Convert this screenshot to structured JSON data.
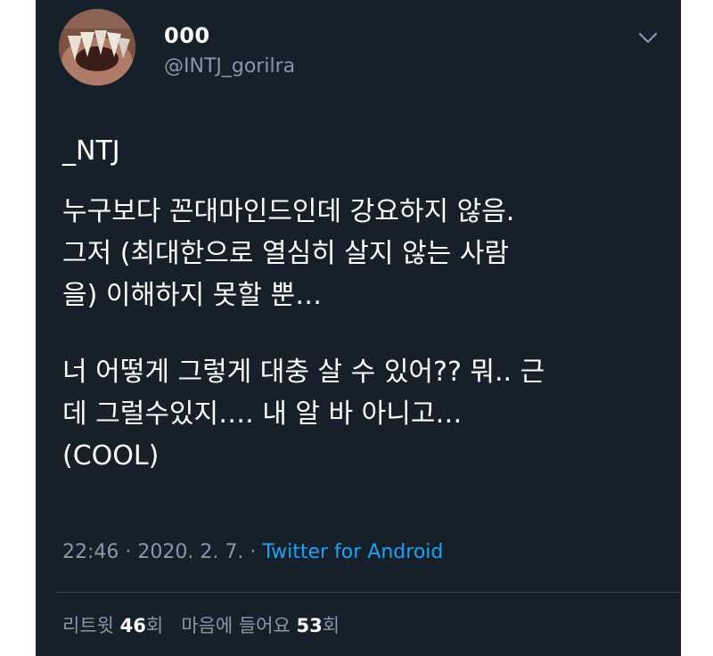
{
  "user": {
    "display_name": "000",
    "handle": "@INTJ_gorilra"
  },
  "tweet": {
    "lines": [
      "_NTJ",
      "누구보다 꼰대마인드인데 강요하지 않음.",
      "그저 (최대한으로 열심히 살지 않는 사람",
      "을) 이해하지 못할 뿐…",
      "너 어떻게 그렇게 대충 살 수 있어?? 뭐.. 근",
      "데 그럴수있지…. 내 알 바 아니고…",
      "(COOL)"
    ]
  },
  "meta": {
    "time": "22:46",
    "separator1": " · ",
    "date": "2020. 2. 7.",
    "separator2": " · ",
    "source": "Twitter for Android"
  },
  "stats": {
    "retweet_label": "리트윗 ",
    "retweet_count": "46",
    "retweet_unit": "회",
    "like_label": "   마음에 들어요 ",
    "like_count": "53",
    "like_unit": "회"
  },
  "icons": {
    "avatar": "avatar-image",
    "menu": "chevron-down-icon"
  }
}
